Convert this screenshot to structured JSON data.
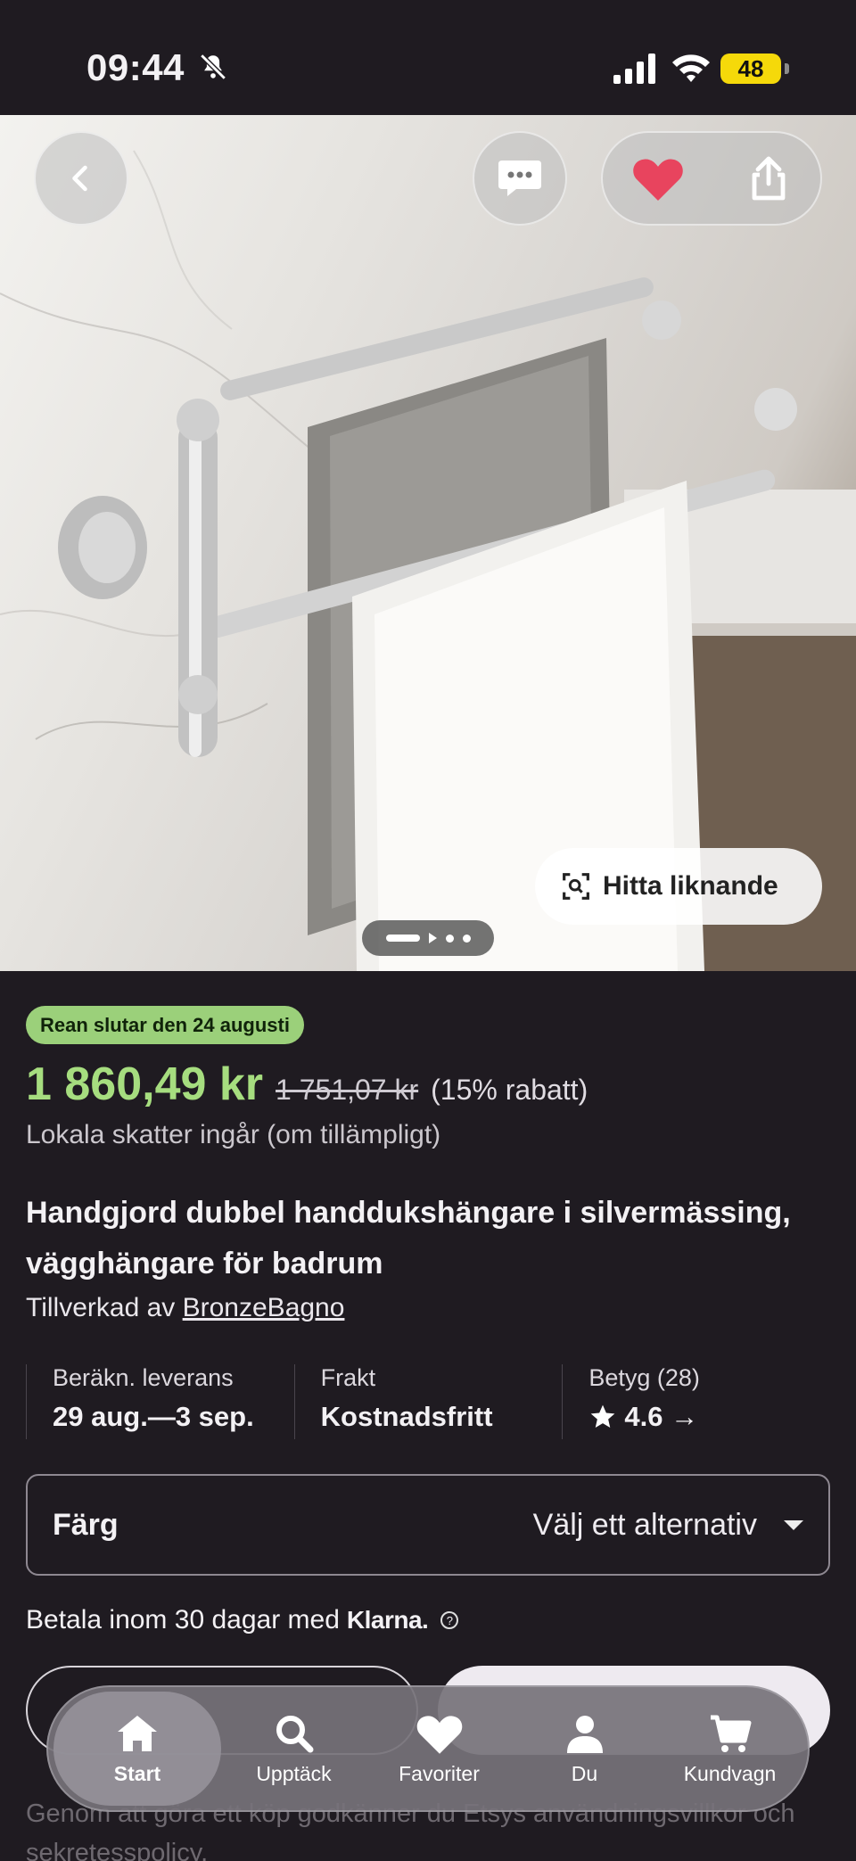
{
  "status_bar": {
    "time": "09:44",
    "battery": "48"
  },
  "hero": {
    "find_similar_label": "Hitta liknande",
    "image_count": 4,
    "current_image": 1
  },
  "product": {
    "sale_badge": "Rean slutar den 24 augusti",
    "price": "1 860,49 kr",
    "original_price": "1 751,07 kr",
    "discount": "(15% rabatt)",
    "tax_note": "Lokala skatter ingår (om tillämpligt)",
    "title": "Handgjord dubbel handdukshängare i silvermässing, vägghängare för badrum",
    "made_by_prefix": "Tillverkad av",
    "shop_name": "BronzeBagno"
  },
  "info": {
    "delivery_label": "Beräkn. leverans",
    "delivery_value": "29 aug.—3 sep.",
    "shipping_label": "Frakt",
    "shipping_value": "Kostnadsfritt",
    "rating_label": "Betyg (28)",
    "rating_value": "4.6 →"
  },
  "variant": {
    "label": "Färg",
    "placeholder": "Välj ett alternativ"
  },
  "payment": {
    "text": "Betala inom 30 dagar med",
    "brand": "Klarna."
  },
  "terms_text": "Genom att göra ett köp godkänner du Etsys användningsvillkor och sekretesspolicy.",
  "tabs": [
    {
      "label": "Start",
      "icon": "home-icon"
    },
    {
      "label": "Upptäck",
      "icon": "search-icon"
    },
    {
      "label": "Favoriter",
      "icon": "heart-icon"
    },
    {
      "label": "Du",
      "icon": "person-icon"
    },
    {
      "label": "Kundvagn",
      "icon": "cart-icon"
    }
  ],
  "colors": {
    "price_green": "#a6dd7f",
    "badge_green": "#9bd07a",
    "heart": "#e8445e",
    "background": "#1f1b21"
  }
}
